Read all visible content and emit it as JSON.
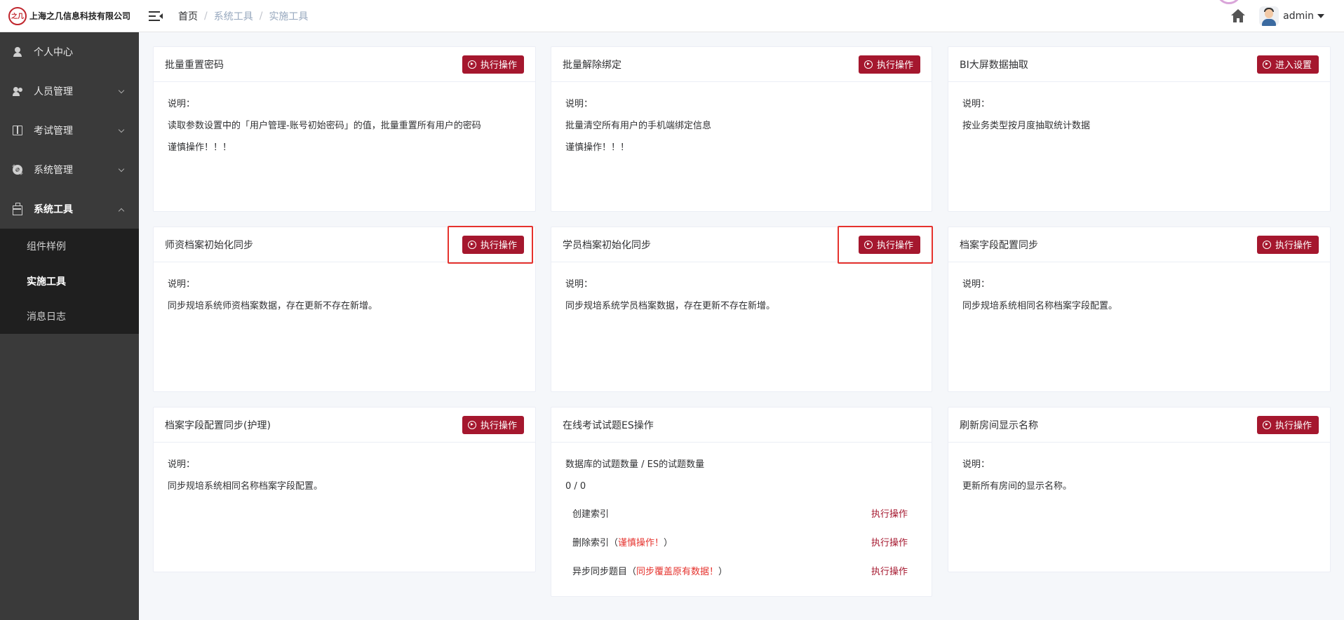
{
  "header": {
    "logo_mark": "之几",
    "company": "上海之几信息科技有限公司",
    "breadcrumb": [
      "首页",
      "系统工具",
      "实施工具"
    ],
    "user": "admin"
  },
  "sidebar": {
    "items": [
      {
        "label": "个人中心"
      },
      {
        "label": "人员管理"
      },
      {
        "label": "考试管理"
      },
      {
        "label": "系统管理"
      },
      {
        "label": "系统工具"
      }
    ],
    "subitems": [
      {
        "label": "组件样例"
      },
      {
        "label": "实施工具"
      },
      {
        "label": "消息日志"
      }
    ]
  },
  "cards": [
    {
      "title": "批量重置密码",
      "button": "执行操作",
      "lines": [
        "说明：",
        "读取参数设置中的「用户管理-账号初始密码」的值，批量重置所有用户的密码",
        "谨慎操作！！！"
      ]
    },
    {
      "title": "批量解除绑定",
      "button": "执行操作",
      "lines": [
        "说明：",
        "批量清空所有用户的手机端绑定信息",
        "谨慎操作！！！"
      ]
    },
    {
      "title": "BI大屏数据抽取",
      "button": "进入设置",
      "lines": [
        "说明：",
        "按业务类型按月度抽取统计数据"
      ]
    },
    {
      "title": "师资档案初始化同步",
      "button": "执行操作",
      "lines": [
        "说明：",
        "同步规培系统师资档案数据，存在更新不存在新增。"
      ]
    },
    {
      "title": "学员档案初始化同步",
      "button": "执行操作",
      "lines": [
        "说明：",
        "同步规培系统学员档案数据，存在更新不存在新增。"
      ]
    },
    {
      "title": "档案字段配置同步",
      "button": "执行操作",
      "lines": [
        "说明：",
        "同步规培系统相同名称档案字段配置。"
      ]
    },
    {
      "title": "档案字段配置同步(护理)",
      "button": "执行操作",
      "lines": [
        "说明：",
        "同步规培系统相同名称档案字段配置。"
      ]
    },
    {
      "title": "在线考试试题ES操作",
      "button": "",
      "lines": [
        "数据库的试题数量 / ES的试题数量",
        "0 / 0"
      ]
    },
    {
      "title": "刷新房间显示名称",
      "button": "执行操作",
      "lines": [
        "说明：",
        "更新所有房间的显示名称。"
      ]
    }
  ],
  "es_rows": [
    {
      "label": "创建索引",
      "paren_open": "",
      "warn": "",
      "paren_close": "",
      "action": "执行操作"
    },
    {
      "label": "删除索引",
      "paren_open": "（",
      "warn": "谨慎操作！",
      "paren_close": "）",
      "action": "执行操作"
    },
    {
      "label": "异步同步题目",
      "paren_open": "（",
      "warn": "同步覆盖原有数据！",
      "paren_close": "）",
      "action": "执行操作"
    }
  ]
}
